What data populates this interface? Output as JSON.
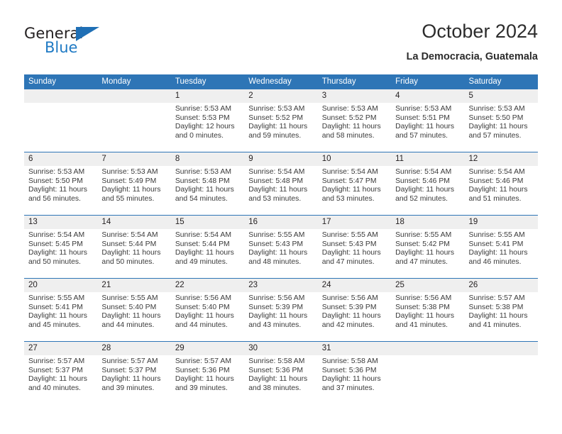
{
  "logo": {
    "word1": "General",
    "word2": "Blue",
    "triangle_icon": "triangle-icon",
    "accent_color": "#1f7ac4"
  },
  "header": {
    "title": "October 2024",
    "subtitle": "La Democracia, Guatemala"
  },
  "calendar": {
    "header_bg": "#2e75b6",
    "daynum_bg": "#efefef",
    "weekday_headers": [
      "Sunday",
      "Monday",
      "Tuesday",
      "Wednesday",
      "Thursday",
      "Friday",
      "Saturday"
    ],
    "weeks": [
      [
        {
          "day": "",
          "empty": true
        },
        {
          "day": "",
          "empty": true
        },
        {
          "day": "1",
          "sunrise": "Sunrise: 5:53 AM",
          "sunset": "Sunset: 5:53 PM",
          "daylight1": "Daylight: 12 hours",
          "daylight2": "and 0 minutes."
        },
        {
          "day": "2",
          "sunrise": "Sunrise: 5:53 AM",
          "sunset": "Sunset: 5:52 PM",
          "daylight1": "Daylight: 11 hours",
          "daylight2": "and 59 minutes."
        },
        {
          "day": "3",
          "sunrise": "Sunrise: 5:53 AM",
          "sunset": "Sunset: 5:52 PM",
          "daylight1": "Daylight: 11 hours",
          "daylight2": "and 58 minutes."
        },
        {
          "day": "4",
          "sunrise": "Sunrise: 5:53 AM",
          "sunset": "Sunset: 5:51 PM",
          "daylight1": "Daylight: 11 hours",
          "daylight2": "and 57 minutes."
        },
        {
          "day": "5",
          "sunrise": "Sunrise: 5:53 AM",
          "sunset": "Sunset: 5:50 PM",
          "daylight1": "Daylight: 11 hours",
          "daylight2": "and 57 minutes."
        }
      ],
      [
        {
          "day": "6",
          "sunrise": "Sunrise: 5:53 AM",
          "sunset": "Sunset: 5:50 PM",
          "daylight1": "Daylight: 11 hours",
          "daylight2": "and 56 minutes."
        },
        {
          "day": "7",
          "sunrise": "Sunrise: 5:53 AM",
          "sunset": "Sunset: 5:49 PM",
          "daylight1": "Daylight: 11 hours",
          "daylight2": "and 55 minutes."
        },
        {
          "day": "8",
          "sunrise": "Sunrise: 5:53 AM",
          "sunset": "Sunset: 5:48 PM",
          "daylight1": "Daylight: 11 hours",
          "daylight2": "and 54 minutes."
        },
        {
          "day": "9",
          "sunrise": "Sunrise: 5:54 AM",
          "sunset": "Sunset: 5:48 PM",
          "daylight1": "Daylight: 11 hours",
          "daylight2": "and 53 minutes."
        },
        {
          "day": "10",
          "sunrise": "Sunrise: 5:54 AM",
          "sunset": "Sunset: 5:47 PM",
          "daylight1": "Daylight: 11 hours",
          "daylight2": "and 53 minutes."
        },
        {
          "day": "11",
          "sunrise": "Sunrise: 5:54 AM",
          "sunset": "Sunset: 5:46 PM",
          "daylight1": "Daylight: 11 hours",
          "daylight2": "and 52 minutes."
        },
        {
          "day": "12",
          "sunrise": "Sunrise: 5:54 AM",
          "sunset": "Sunset: 5:46 PM",
          "daylight1": "Daylight: 11 hours",
          "daylight2": "and 51 minutes."
        }
      ],
      [
        {
          "day": "13",
          "sunrise": "Sunrise: 5:54 AM",
          "sunset": "Sunset: 5:45 PM",
          "daylight1": "Daylight: 11 hours",
          "daylight2": "and 50 minutes."
        },
        {
          "day": "14",
          "sunrise": "Sunrise: 5:54 AM",
          "sunset": "Sunset: 5:44 PM",
          "daylight1": "Daylight: 11 hours",
          "daylight2": "and 50 minutes."
        },
        {
          "day": "15",
          "sunrise": "Sunrise: 5:54 AM",
          "sunset": "Sunset: 5:44 PM",
          "daylight1": "Daylight: 11 hours",
          "daylight2": "and 49 minutes."
        },
        {
          "day": "16",
          "sunrise": "Sunrise: 5:55 AM",
          "sunset": "Sunset: 5:43 PM",
          "daylight1": "Daylight: 11 hours",
          "daylight2": "and 48 minutes."
        },
        {
          "day": "17",
          "sunrise": "Sunrise: 5:55 AM",
          "sunset": "Sunset: 5:43 PM",
          "daylight1": "Daylight: 11 hours",
          "daylight2": "and 47 minutes."
        },
        {
          "day": "18",
          "sunrise": "Sunrise: 5:55 AM",
          "sunset": "Sunset: 5:42 PM",
          "daylight1": "Daylight: 11 hours",
          "daylight2": "and 47 minutes."
        },
        {
          "day": "19",
          "sunrise": "Sunrise: 5:55 AM",
          "sunset": "Sunset: 5:41 PM",
          "daylight1": "Daylight: 11 hours",
          "daylight2": "and 46 minutes."
        }
      ],
      [
        {
          "day": "20",
          "sunrise": "Sunrise: 5:55 AM",
          "sunset": "Sunset: 5:41 PM",
          "daylight1": "Daylight: 11 hours",
          "daylight2": "and 45 minutes."
        },
        {
          "day": "21",
          "sunrise": "Sunrise: 5:55 AM",
          "sunset": "Sunset: 5:40 PM",
          "daylight1": "Daylight: 11 hours",
          "daylight2": "and 44 minutes."
        },
        {
          "day": "22",
          "sunrise": "Sunrise: 5:56 AM",
          "sunset": "Sunset: 5:40 PM",
          "daylight1": "Daylight: 11 hours",
          "daylight2": "and 44 minutes."
        },
        {
          "day": "23",
          "sunrise": "Sunrise: 5:56 AM",
          "sunset": "Sunset: 5:39 PM",
          "daylight1": "Daylight: 11 hours",
          "daylight2": "and 43 minutes."
        },
        {
          "day": "24",
          "sunrise": "Sunrise: 5:56 AM",
          "sunset": "Sunset: 5:39 PM",
          "daylight1": "Daylight: 11 hours",
          "daylight2": "and 42 minutes."
        },
        {
          "day": "25",
          "sunrise": "Sunrise: 5:56 AM",
          "sunset": "Sunset: 5:38 PM",
          "daylight1": "Daylight: 11 hours",
          "daylight2": "and 41 minutes."
        },
        {
          "day": "26",
          "sunrise": "Sunrise: 5:57 AM",
          "sunset": "Sunset: 5:38 PM",
          "daylight1": "Daylight: 11 hours",
          "daylight2": "and 41 minutes."
        }
      ],
      [
        {
          "day": "27",
          "sunrise": "Sunrise: 5:57 AM",
          "sunset": "Sunset: 5:37 PM",
          "daylight1": "Daylight: 11 hours",
          "daylight2": "and 40 minutes."
        },
        {
          "day": "28",
          "sunrise": "Sunrise: 5:57 AM",
          "sunset": "Sunset: 5:37 PM",
          "daylight1": "Daylight: 11 hours",
          "daylight2": "and 39 minutes."
        },
        {
          "day": "29",
          "sunrise": "Sunrise: 5:57 AM",
          "sunset": "Sunset: 5:36 PM",
          "daylight1": "Daylight: 11 hours",
          "daylight2": "and 39 minutes."
        },
        {
          "day": "30",
          "sunrise": "Sunrise: 5:58 AM",
          "sunset": "Sunset: 5:36 PM",
          "daylight1": "Daylight: 11 hours",
          "daylight2": "and 38 minutes."
        },
        {
          "day": "31",
          "sunrise": "Sunrise: 5:58 AM",
          "sunset": "Sunset: 5:36 PM",
          "daylight1": "Daylight: 11 hours",
          "daylight2": "and 37 minutes."
        },
        {
          "day": "",
          "empty": true
        },
        {
          "day": "",
          "empty": true
        }
      ]
    ]
  }
}
